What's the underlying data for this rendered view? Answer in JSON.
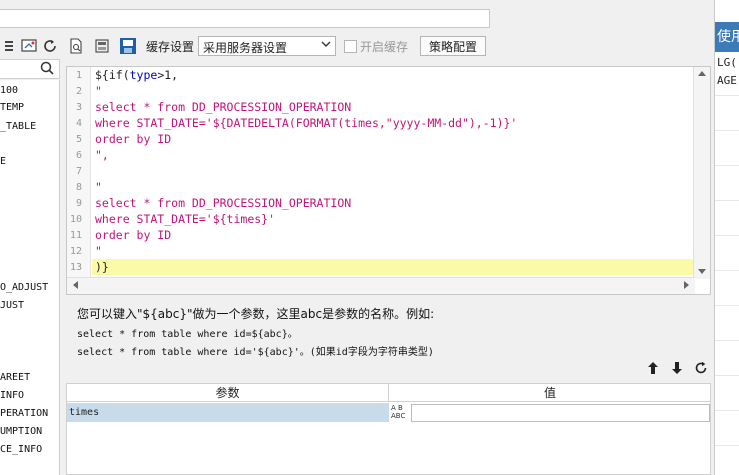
{
  "left_panel": {
    "items": [
      "100",
      "TEMP",
      "_TABLE",
      "E",
      "O_ADJUST",
      "JUST",
      "AREET",
      "INFO",
      "PERATION",
      "UMPTION",
      "CE_INFO"
    ]
  },
  "toolbar": {
    "cache_label": "缓存设置",
    "cache_select": "采用服务器设置",
    "enable_cache": "开启缓存",
    "strategy_button": "策略配置"
  },
  "editor": {
    "line_numbers": [
      "1",
      "2",
      "3",
      "4",
      "5",
      "6",
      "7",
      "8",
      "9",
      "10",
      "11",
      "12",
      "13"
    ],
    "lines": [
      [
        "${if(",
        "type",
        ">1,"
      ],
      [
        "\""
      ],
      [
        "select * from DD_PROCESSION_OPERATION"
      ],
      [
        "where STAT_DATE='${DATEDELTA(FORMAT(times,\"yyyy-MM-dd\"),-1)}'"
      ],
      [
        "order by ID"
      ],
      [
        "\","
      ],
      [
        ""
      ],
      [
        "\""
      ],
      [
        "select * from DD_PROCESSION_OPERATION"
      ],
      [
        "where STAT_DATE='${times}'"
      ],
      [
        "order by ID"
      ],
      [
        "\""
      ],
      [
        ")}"
      ]
    ]
  },
  "hint": {
    "line1": "您可以键入\"${abc}\"做为一个参数，这里abc是参数的名称。例如:",
    "line2": "select * from table where id=${abc}。",
    "line3": "select * from table where id='${abc}'。(如果id字段为字符串类型)"
  },
  "params": {
    "col_param": "参数",
    "col_value": "值",
    "rows": [
      {
        "name": "times",
        "type_icon": "A B ABC",
        "value": ""
      }
    ]
  },
  "right_panel": {
    "header": "使用",
    "line1": "LG(",
    "line2": "AGE"
  },
  "colors": {
    "keyword": "#0000cc",
    "string": "#c0157a",
    "active_line": "#fafaa8",
    "selected_row": "#c7dbeb",
    "accent": "#3d7ab8"
  }
}
